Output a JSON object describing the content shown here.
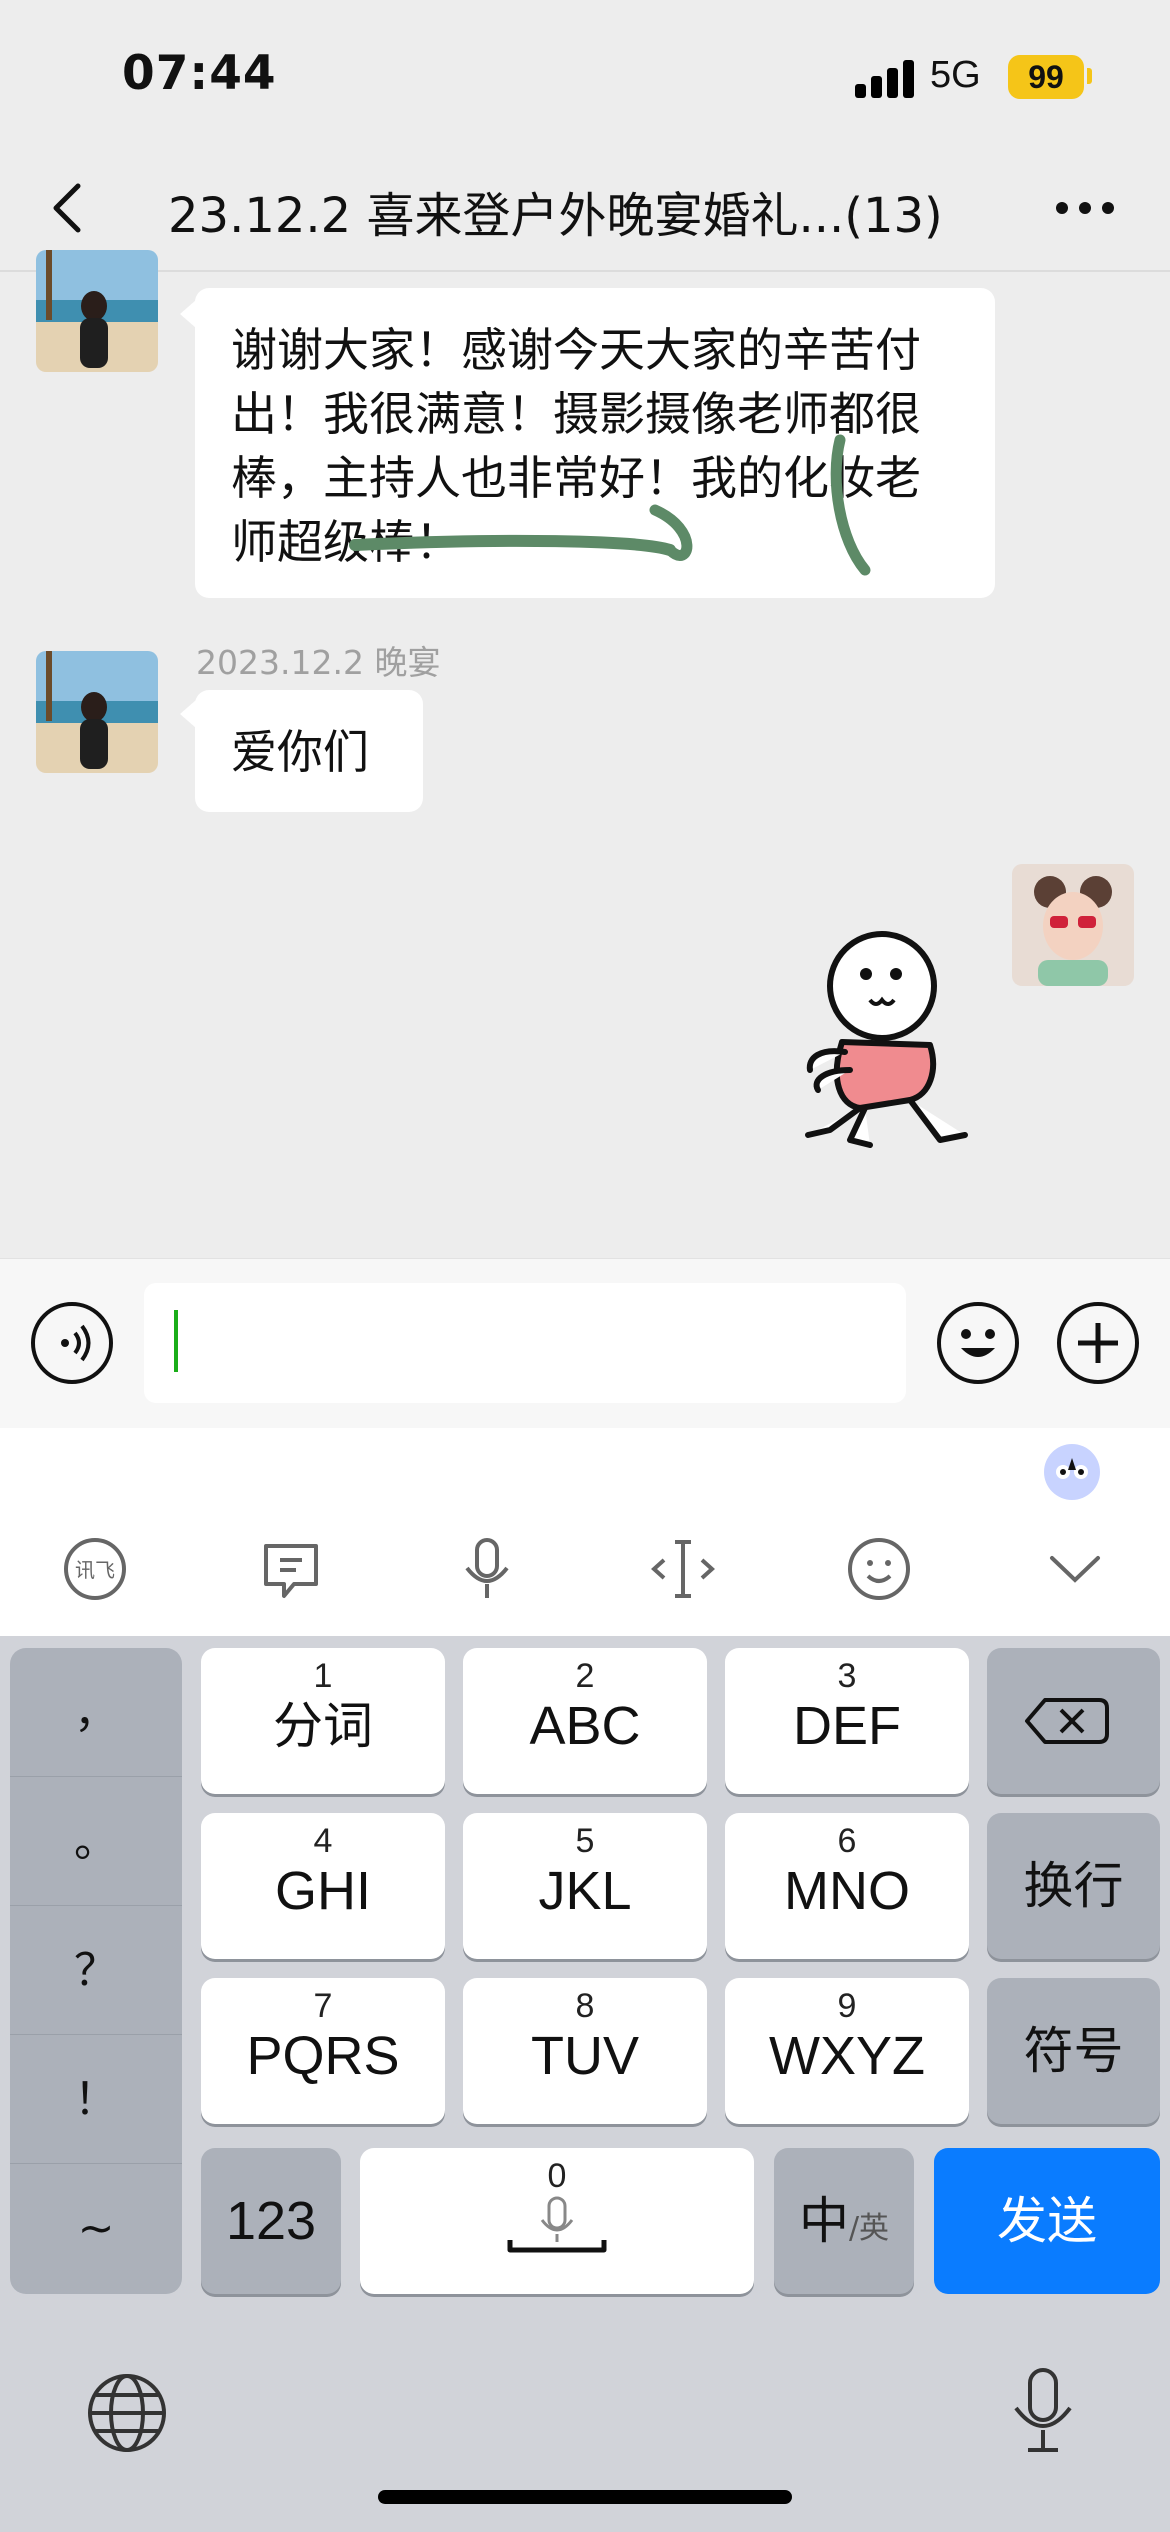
{
  "status_bar": {
    "time": "07:44",
    "network": "5G",
    "battery": "99"
  },
  "header": {
    "title": "23.12.2 喜来登户外晚宴婚礼...(13)"
  },
  "messages": [
    {
      "text": "谢谢大家！感谢今天大家的辛苦付出！我很满意！摄影摄像老师都很棒，主持人也非常好！我的化妆老师超级棒！"
    },
    {
      "timestamp": "2023.12.2 晚宴",
      "text": "爱你们"
    }
  ],
  "input": {
    "placeholder": ""
  },
  "keyboard": {
    "punctuation": [
      "，",
      "。",
      "？",
      "！",
      "~"
    ],
    "rows": [
      [
        {
          "num": "1",
          "label": "分词"
        },
        {
          "num": "2",
          "label": "ABC"
        },
        {
          "num": "3",
          "label": "DEF"
        }
      ],
      [
        {
          "num": "4",
          "label": "GHI"
        },
        {
          "num": "5",
          "label": "JKL"
        },
        {
          "num": "6",
          "label": "MNO"
        }
      ],
      [
        {
          "num": "7",
          "label": "PQRS"
        },
        {
          "num": "8",
          "label": "TUV"
        },
        {
          "num": "9",
          "label": "WXYZ"
        }
      ]
    ],
    "newline": "换行",
    "symbols": "符号",
    "numbers": "123",
    "space_num": "0",
    "lang_main": "中",
    "lang_alt": "/英",
    "send": "发送"
  },
  "icons": [
    "back-icon",
    "more-icon",
    "voice-icon",
    "emoji-icon",
    "plus-icon",
    "backspace-icon",
    "globe-icon",
    "mic-icon"
  ],
  "colors": {
    "accent": "#0a7cff",
    "caret": "#1aad19",
    "battery": "#f5c518"
  }
}
